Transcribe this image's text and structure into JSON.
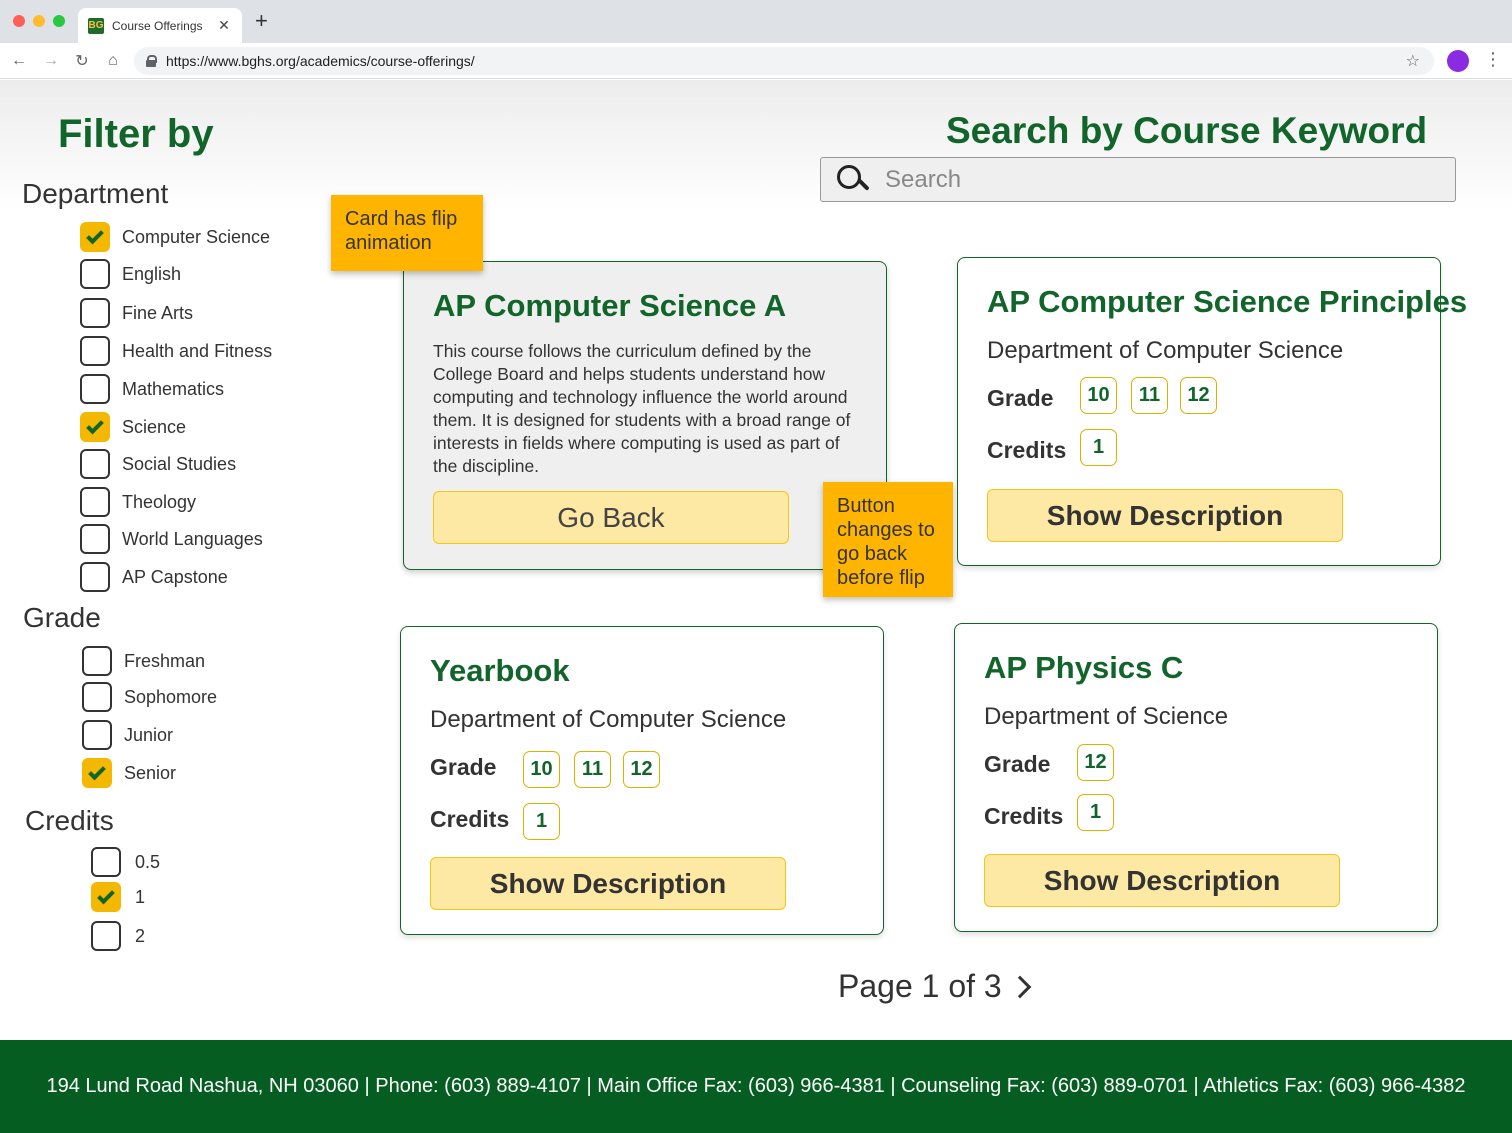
{
  "browser": {
    "tab_title": "Course Offerings",
    "favicon_text": "BG",
    "url": "https://www.bghs.org/academics/course-offerings/"
  },
  "filters": {
    "title": "Filter by",
    "department": {
      "heading": "Department",
      "options": [
        {
          "label": "Computer Science",
          "checked": true
        },
        {
          "label": "English",
          "checked": false
        },
        {
          "label": "Fine Arts",
          "checked": false
        },
        {
          "label": "Health and Fitness",
          "checked": false
        },
        {
          "label": "Mathematics",
          "checked": false
        },
        {
          "label": "Science",
          "checked": true
        },
        {
          "label": "Social Studies",
          "checked": false
        },
        {
          "label": "Theology",
          "checked": false
        },
        {
          "label": "World Languages",
          "checked": false
        },
        {
          "label": "AP Capstone",
          "checked": false
        }
      ]
    },
    "grade": {
      "heading": "Grade",
      "options": [
        {
          "label": "Freshman",
          "checked": false
        },
        {
          "label": "Sophomore",
          "checked": false
        },
        {
          "label": "Junior",
          "checked": false
        },
        {
          "label": "Senior",
          "checked": true
        }
      ]
    },
    "credits": {
      "heading": "Credits",
      "options": [
        {
          "label": "0.5",
          "checked": false
        },
        {
          "label": "1",
          "checked": true
        },
        {
          "label": "2",
          "checked": false
        }
      ]
    }
  },
  "search": {
    "title": "Search by Course Keyword",
    "placeholder": "Search",
    "value": ""
  },
  "cards": [
    {
      "title": "AP Computer Science A",
      "flipped": true,
      "description": "This course follows the curriculum defined by the College Board and helps students understand how computing and technology influence the world around them. It is designed for students with a broad range of interests in fields where computing is used as part of the discipline.",
      "button": "Go Back"
    },
    {
      "title": "AP Computer Science Principles",
      "department": "Department of Computer Science",
      "grade_label": "Grade",
      "grades": [
        "10",
        "11",
        "12"
      ],
      "credits_label": "Credits",
      "credits": "1",
      "button": "Show Description"
    },
    {
      "title": "Yearbook",
      "department": "Department of Computer Science",
      "grade_label": "Grade",
      "grades": [
        "10",
        "11",
        "12"
      ],
      "credits_label": "Credits",
      "credits": "1",
      "button": "Show Description"
    },
    {
      "title": "AP Physics C",
      "department": "Department of Science",
      "grade_label": "Grade",
      "grades": [
        "12"
      ],
      "credits_label": "Credits",
      "credits": "1",
      "button": "Show Description"
    }
  ],
  "annotations": {
    "card_flip": "Card has flip animation",
    "button_change": "Button changes to go back before flip"
  },
  "pagination": {
    "text": "Page 1 of 3"
  },
  "footer": {
    "text": "194 Lund Road Nashua, NH 03060 | Phone: (603) 889-4107 | Main Office Fax: (603) 966-4381 | Counseling Fax: (603) 889-0701 | Athletics Fax: (603) 966-4382"
  },
  "colors": {
    "brand_green": "#12652a",
    "accent_gold": "#f5b800",
    "footer_green": "#055d22",
    "note_orange": "#ffb400"
  }
}
